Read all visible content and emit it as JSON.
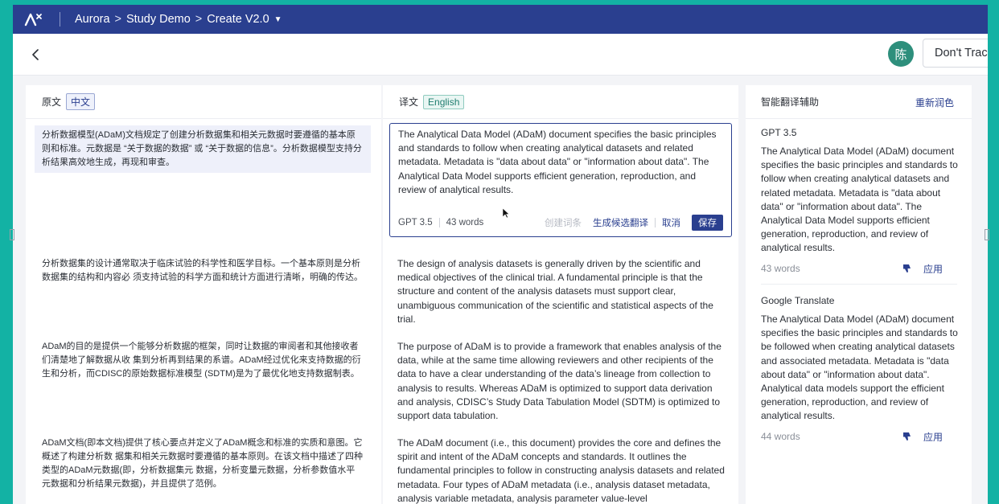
{
  "topbar": {
    "breadcrumb": [
      "Aurora",
      "Study Demo",
      "Create V2.0"
    ]
  },
  "header": {
    "avatar": "陈",
    "dont_track": "Don't Trac"
  },
  "source": {
    "label": "原文",
    "lang": "中文",
    "blocks": [
      "分析数据模型(ADaM)文档规定了创建分析数据集和相关元数据时要遵循的基本原则和标准。元数据是 “关于数据的数据” 或 “关于数据的信息”。分析数据模型支持分析结果高效地生成，再现和审查。",
      "分析数据集的设计通常取决于临床试验的科学性和医学目标。一个基本原则是分析数据集的结构和内容必 须支持试验的科学方面和统计方面进行清晰，明确的传达。",
      "ADaM的目的是提供一个能够分析数据的框架，同时让数据的审阅者和其他接收者们清楚地了解数据从收 集到分析再到结果的系谱。ADaM经过优化来支持数据的衍生和分析，而CDISC的原始数据标准模型 (SDTM)是为了最优化地支持数据制表。",
      "ADaM文档(即本文档)提供了核心要点并定义了ADaM概念和标准的实质和意图。它概述了构建分析数 据集和相关元数据时要遵循的基本原则。在该文档中描述了四种类型的ADaM元数据(即，分析数据集元 数据，分析变量元数据，分析参数值水平元数据和分析结果元数据)，并且提供了范例。"
    ]
  },
  "translation": {
    "label": "译文",
    "lang": "English",
    "editor": {
      "text": "The Analytical Data Model (ADaM) document specifies the basic principles and standards to follow when creating analytical datasets and related metadata. Metadata is \"data about data\" or \"information about data\". The Analytical Data Model supports efficient generation, reproduction, and review of analytical results.",
      "model": "GPT 3.5",
      "words": "43 words",
      "create_term": "创建词条",
      "gen_candidates": "生成候选翻译",
      "cancel": "取消",
      "save": "保存"
    },
    "blocks": [
      "The design of analysis datasets is generally driven by the scientific and medical objectives of the clinical trial. A fundamental principle is that the structure and content of the analysis datasets must support clear, unambiguous communication of the scientific and statistical aspects of the trial.",
      "The purpose of ADaM is to provide a framework that enables analysis of the data, while at the same time allowing reviewers and other recipients of the data to have a clear understanding of the data’s lineage from collection to analysis to results. Whereas ADaM is optimized to support data derivation and analysis, CDISC’s Study Data Tabulation Model (SDTM) is optimized to support data tabulation.",
      "The ADaM document (i.e., this document) provides the core and defines the spirit and intent of the ADaM concepts and standards. It outlines the fundamental principles to follow in constructing analysis datasets and related metadata. Four types of ADaM metadata (i.e., analysis dataset metadata, analysis variable metadata, analysis parameter value-level"
    ]
  },
  "assistant": {
    "title": "智能翻译辅助",
    "recolor": "重新润色",
    "apply": "应用",
    "engines": [
      {
        "name": "GPT 3.5",
        "text": "The Analytical Data Model (ADaM) document specifies the basic principles and standards to follow when creating analytical datasets and related metadata. Metadata is \"data about data\" or \"information about data\". The Analytical Data Model supports efficient generation, reproduction, and review of analytical results.",
        "words": "43 words"
      },
      {
        "name": "Google Translate",
        "text": "The Analytical Data Model (ADaM) document specifies the basic principles and standards to be followed when creating analytical datasets and associated metadata. Metadata is \"data about data\" or \"information about data\". Analytical data models support the efficient generation, reproduction, and review of analytical results.",
        "words": "44 words"
      }
    ]
  }
}
